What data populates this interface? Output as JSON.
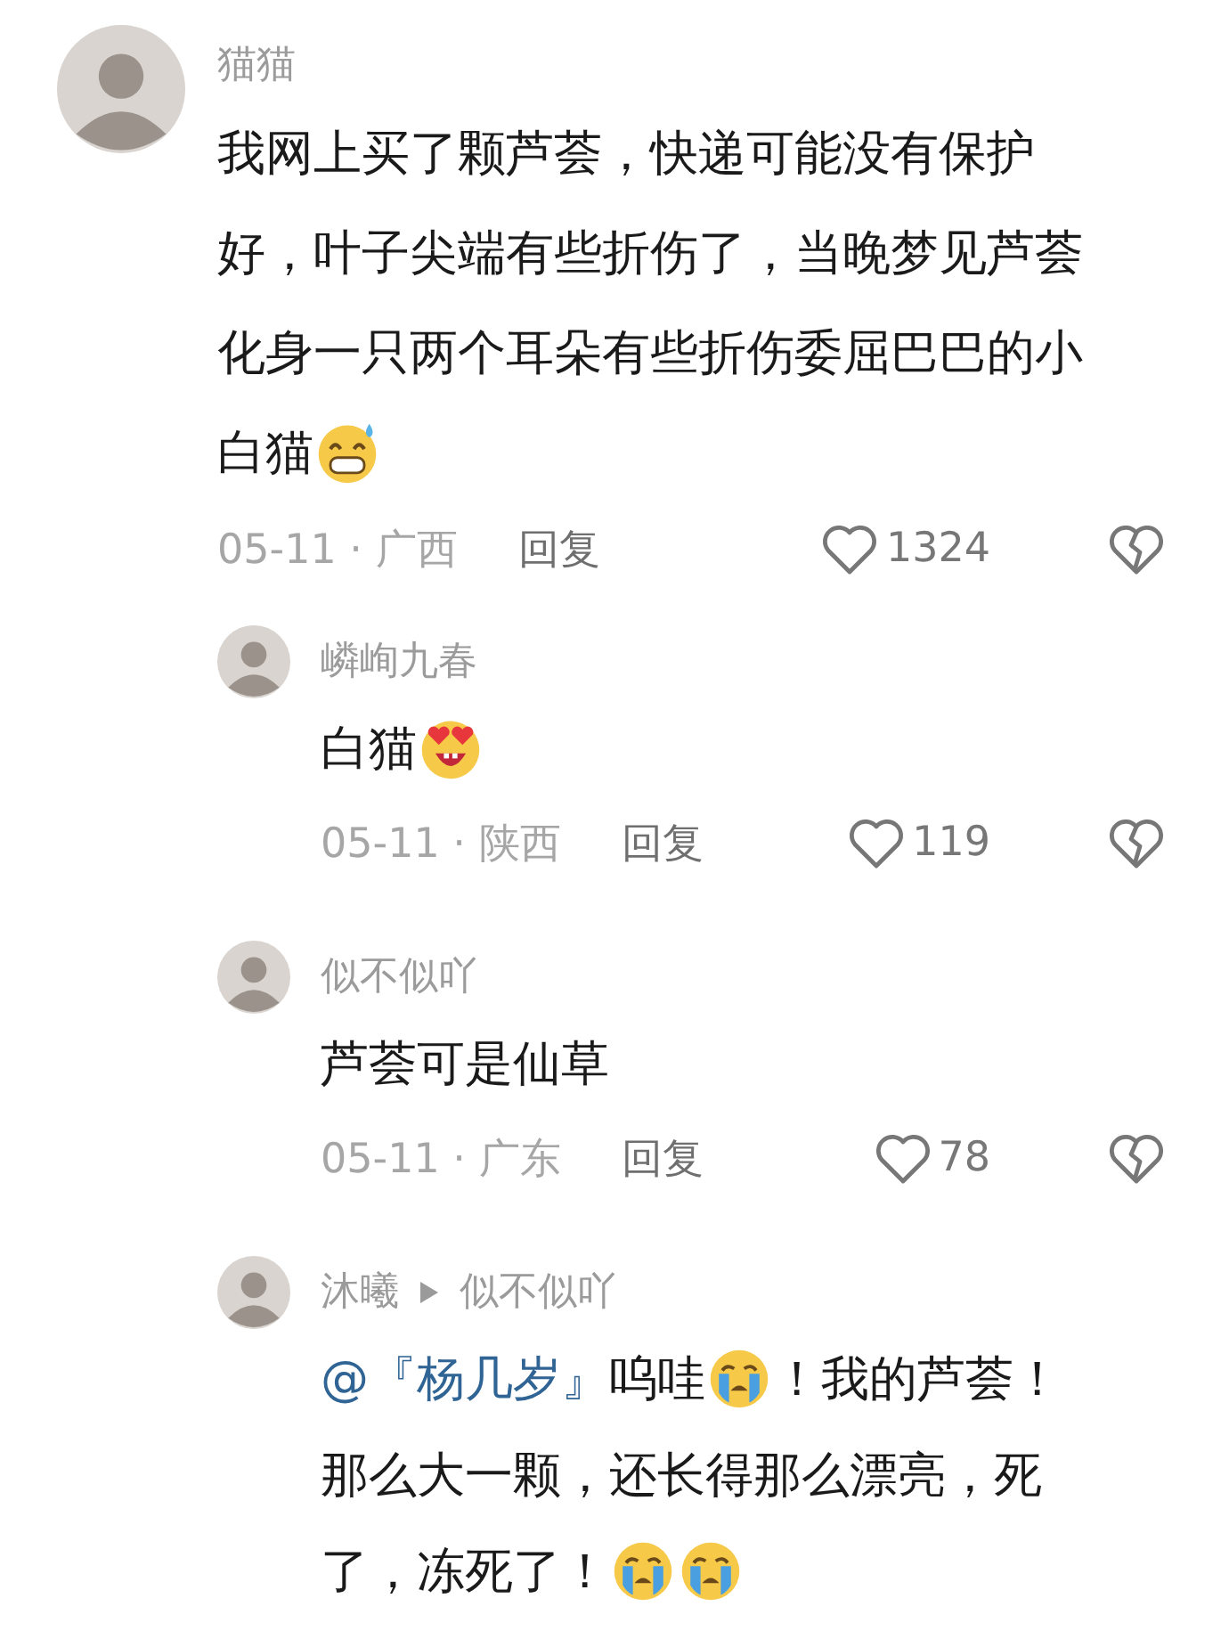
{
  "comment": {
    "user": "猫猫",
    "lines": [
      [
        {
          "kind": "text",
          "text": "我网上买了颗芦荟，快递可能没有保护"
        }
      ],
      [
        {
          "kind": "text",
          "text": "好，叶子尖端有些折伤了，当晚梦见芦荟"
        }
      ],
      [
        {
          "kind": "text",
          "text": "化身一只两个耳朵有些折伤委屈巴巴的小"
        }
      ],
      [
        {
          "kind": "text",
          "text": "白猫"
        },
        {
          "kind": "emoji_sweat_grin"
        }
      ]
    ],
    "meta": "05-11 · 广西",
    "reply": "回复",
    "likes": "1324",
    "replies": [
      {
        "user": "嶙峋九春",
        "lines": [
          [
            {
              "kind": "text",
              "text": "白猫"
            },
            {
              "kind": "emoji_heart_eyes"
            }
          ]
        ],
        "meta": "05-11 · 陕西",
        "reply": "回复",
        "likes": "119"
      },
      {
        "user": "似不似吖",
        "lines": [
          [
            {
              "kind": "text",
              "text": "芦荟可是仙草"
            }
          ]
        ],
        "meta": "05-11 · 广东",
        "reply": "回复",
        "likes": "78"
      },
      {
        "user": "沐曦",
        "reply_to": "似不似吖",
        "lines": [
          [
            {
              "kind": "mention",
              "text": "@『杨几岁』"
            },
            {
              "kind": "text",
              "text": " 呜哇"
            },
            {
              "kind": "emoji_crying"
            },
            {
              "kind": "text",
              "text": "！我的芦荟！"
            }
          ],
          [
            {
              "kind": "text",
              "text": "那么大一颗，还长得那么漂亮，死"
            }
          ],
          [
            {
              "kind": "text",
              "text": "了，冻死了！"
            },
            {
              "kind": "emoji_crying"
            },
            {
              "kind": "emoji_crying"
            }
          ]
        ]
      }
    ]
  }
}
